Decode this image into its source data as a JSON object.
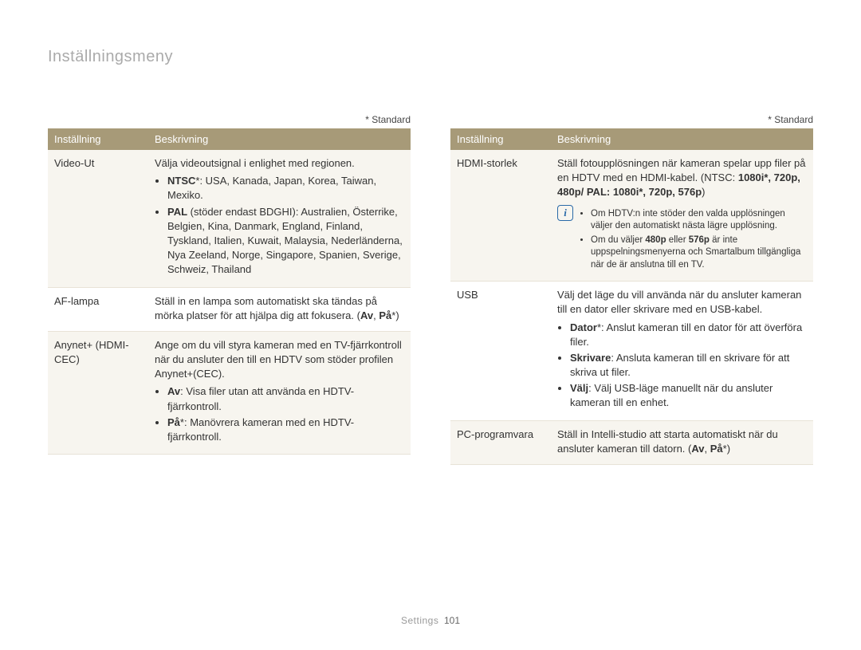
{
  "pageTitle": "Inställningsmeny",
  "standardLabel": "* Standard",
  "headers": {
    "setting": "Inställning",
    "description": "Beskrivning"
  },
  "left": {
    "videoOut": {
      "label": "Video-Ut",
      "intro": "Välja videoutsignal i enlighet med regionen.",
      "ntsc_label": "NTSC",
      "ntsc_text": "*: USA, Kanada, Japan, Korea, Taiwan, Mexiko.",
      "pal_label": "PAL",
      "pal_text": " (stöder endast BDGHI): Australien, Österrike, Belgien, Kina, Danmark, England, Finland, Tyskland, Italien, Kuwait, Malaysia, Nederländerna, Nya Zeeland, Norge, Singapore, Spanien, Sverige, Schweiz, Thailand"
    },
    "afLamp": {
      "label": "AF-lampa",
      "text": "Ställ in en lampa som automatiskt ska tändas på mörka platser för att hjälpa dig att fokusera. ",
      "options_pre": "(",
      "opt1": "Av",
      "sep": ", ",
      "opt2": "På",
      "options_post": "*)"
    },
    "anynet": {
      "label": "Anynet+ (HDMI-CEC)",
      "intro": "Ange om du vill styra kameran med en TV-fjärrkontroll när du ansluter den till en HDTV som stöder profilen Anynet+(CEC).",
      "off_label": "Av",
      "off_text": ": Visa filer utan att använda en HDTV-fjärrkontroll.",
      "on_label": "På",
      "on_text": "*: Manövrera kameran med en HDTV-fjärrkontroll."
    }
  },
  "right": {
    "hdmiSize": {
      "label": "HDMI-storlek",
      "text1": "Ställ fotoupplösningen när kameran spelar upp filer på en HDTV med en HDMI-kabel. (NTSC: ",
      "opts": "1080i*, 720p, 480p/ PAL: 1080i*, 720p, 576p",
      "text2": ")",
      "note1": "Om HDTV:n inte stöder den valda upplösningen väljer den automatiskt nästa lägre upplösning.",
      "note2a": "Om du väljer ",
      "note2b": "480p",
      "note2c": " eller ",
      "note2d": "576p",
      "note2e": " är inte uppspelningsmenyerna och Smartalbum tillgängliga när de är anslutna till en TV."
    },
    "usb": {
      "label": "USB",
      "intro": "Välj det läge du vill använda när du ansluter kameran till en dator eller skrivare med en USB-kabel.",
      "dator_label": "Dator",
      "dator_text": "*: Anslut kameran till en dator för att överföra filer.",
      "skrivare_label": "Skrivare",
      "skrivare_text": ": Ansluta kameran till en skrivare för att skriva ut filer.",
      "valj_label": "Välj",
      "valj_text": ": Välj USB-läge manuellt när du ansluter kameran till en enhet."
    },
    "pcSoftware": {
      "label": "PC-programvara",
      "text": "Ställ in Intelli-studio att starta automatiskt när du ansluter kameran till datorn. (",
      "opt1": "Av",
      "sep": ", ",
      "opt2": "På",
      "post": "*)"
    }
  },
  "footer": {
    "section": "Settings",
    "page": "101"
  }
}
